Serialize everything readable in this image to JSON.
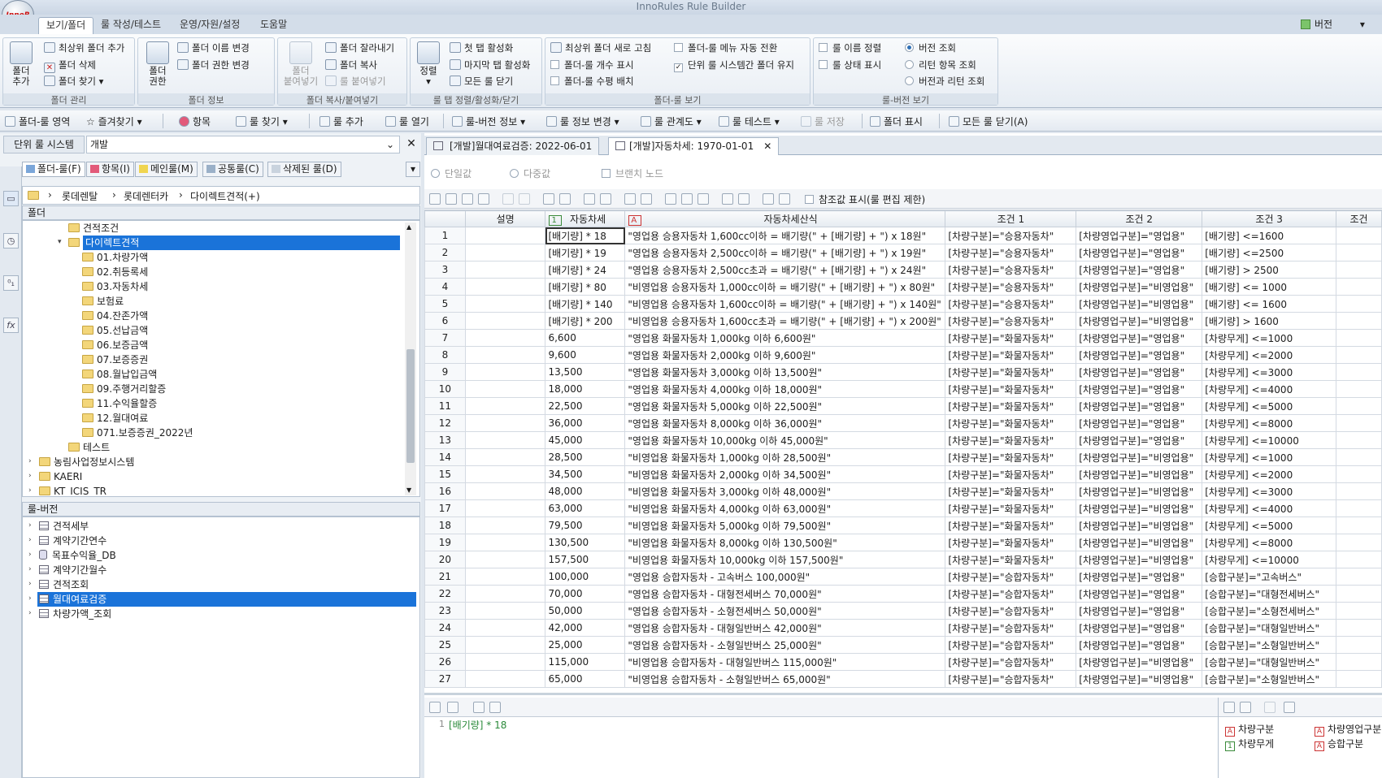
{
  "app": {
    "title": "InnoRules Rule Builder",
    "logo_text": "InnoR"
  },
  "ribbon_tabs": [
    "보기/폴더",
    "룰 작성/테스트",
    "운영/자원/설정",
    "도움말"
  ],
  "version_menu": "버전",
  "ribbon": {
    "folder_mgmt": {
      "caption": "폴더 관리",
      "add_folder": "폴더\n추가",
      "add_top": "최상위 폴더 추가",
      "delete": "폴더 삭제",
      "find": "폴더 찾기"
    },
    "folder_info": {
      "caption": "폴더 정보",
      "perm": "폴더\n권한",
      "rename": "폴더 이름 변경",
      "perm_change": "폴더 권한 변경"
    },
    "folder_copy": {
      "caption": "폴더 복사/붙여넣기",
      "paste": "폴더\n붙여넣기",
      "cut": "폴더 잘라내기",
      "copy": "폴더 복사",
      "paste_rule": "룰 붙여넣기"
    },
    "tab_sort": {
      "caption": "룰 탭 정렬/활성화/닫기",
      "sort": "정렬",
      "first": "첫 탭 활성화",
      "last": "마지막 탭 활성화",
      "close_all": "모든 룰 닫기"
    },
    "folder_rule_view": {
      "caption": "폴더-룰 보기",
      "refresh_top": "최상위 폴더 새로 고침",
      "show_count": "폴더-룰 개수 표시",
      "level": "폴더-룰 수평 배치",
      "menu_auto": "폴더-룰 메뉴 자동 전환",
      "keep_folder": "단위 룰 시스템간 폴더 유지"
    },
    "rule_version_view": {
      "caption": "룰-버전 보기",
      "name_sort": "룰 이름 정렬",
      "status": "룰 상태 표시",
      "ver_query": "버전 조회",
      "return_query": "리턴 항목 조회",
      "ver_return": "버전과 리턴 조회"
    }
  },
  "toolbar": [
    "폴더-룰 영역",
    "즐겨찾기",
    "항목",
    "룰 찾기",
    "룰 추가",
    "룰 열기",
    "룰-버전 정보",
    "룰 정보 변경",
    "룰 관계도",
    "룰 테스트",
    "룰 저장",
    "폴더 표시",
    "모든 룰 닫기(A)"
  ],
  "rule_system": {
    "label": "단위 룰 시스템",
    "value": "개발"
  },
  "left_tabs": [
    "폴더-룰(F)",
    "항목(I)",
    "메인룰(M)",
    "공통룰(C)",
    "삭제된 룰(D)"
  ],
  "breadcrumb": [
    "롯데렌탈",
    "롯데렌터카",
    "다이렉트견적(+)"
  ],
  "folder_header": "폴더",
  "folder_tree": [
    "견적조건",
    "다이렉트견적",
    "01.차량가액",
    "02.취등록세",
    "03.자동차세",
    "보험료",
    "04.잔존가액",
    "05.선납금액",
    "06.보증금액",
    "07.보증증권",
    "08.월납입금액",
    "09.주행거리할증",
    "11.수익율할증",
    "12.월대여료",
    "071.보증증권_2022년",
    "테스트",
    "농림사업정보시스템",
    "KAERI",
    "KT_ICIS_TR"
  ],
  "rule_header": "룰-버전",
  "rule_tree": [
    "견적세부",
    "계약기간연수",
    "목표수익율_DB",
    "계약기간월수",
    "견적조회",
    "월대여료검증",
    "차량가액_조회"
  ],
  "doc_tabs": [
    "[개발]월대여료검증: 2022-06-01",
    "[개발]자동차세: 1970-01-01"
  ],
  "value_options": {
    "single": "단일값",
    "multi": "다중값",
    "branch": "브랜치 노드"
  },
  "grid_toolbar": {
    "ref_display": "참조값 표시(룰 편집 제한)"
  },
  "columns": [
    "설명",
    "자동차세",
    "자동차세산식",
    "조건 1",
    "조건 2",
    "조건 3",
    "조건"
  ],
  "rows": [
    [
      "1",
      "",
      "[배기량] * 18",
      "\"영업용 승용자동차 1,600cc이하 = 배기량(\" + [배기량] + \") x 18원\"",
      "[차량구분]=\"승용자동차\"",
      "[차량영업구분]=\"영업용\"",
      "[배기량] <=1600"
    ],
    [
      "2",
      "",
      "[배기량] * 19",
      "\"영업용 승용자동차 2,500cc이하 = 배기량(\" + [배기량] + \") x 19원\"",
      "[차량구분]=\"승용자동차\"",
      "[차량영업구분]=\"영업용\"",
      "[배기량] <=2500"
    ],
    [
      "3",
      "",
      "[배기량] * 24",
      "\"영업용 승용자동차 2,500cc초과 = 배기량(\" + [배기량] + \") x 24원\"",
      "[차량구분]=\"승용자동차\"",
      "[차량영업구분]=\"영업용\"",
      "[배기량] > 2500"
    ],
    [
      "4",
      "",
      "[배기량] * 80",
      "\"비영업용 승용자동차 1,000cc이하 = 배기량(\" + [배기량] + \") x 80원\"",
      "[차량구분]=\"승용자동차\"",
      "[차량영업구분]=\"비영업용\"",
      "[배기량] <= 1000"
    ],
    [
      "5",
      "",
      "[배기량] * 140",
      "\"비영업용 승용자동차 1,600cc이하 = 배기량(\" + [배기량] + \") x 140원\"",
      "[차량구분]=\"승용자동차\"",
      "[차량영업구분]=\"비영업용\"",
      "[배기량] <= 1600"
    ],
    [
      "6",
      "",
      "[배기량] * 200",
      "\"비영업용 승용자동차 1,600cc초과 = 배기량(\" + [배기량] + \") x 200원\"",
      "[차량구분]=\"승용자동차\"",
      "[차량영업구분]=\"비영업용\"",
      "[배기량] > 1600"
    ],
    [
      "7",
      "",
      "6,600",
      "\"영업용 화물자동차 1,000kg 이하 6,600원\"",
      "[차량구분]=\"화물자동차\"",
      "[차량영업구분]=\"영업용\"",
      "[차량무게] <=1000"
    ],
    [
      "8",
      "",
      "9,600",
      "\"영업용 화물자동차 2,000kg 이하 9,600원\"",
      "[차량구분]=\"화물자동차\"",
      "[차량영업구분]=\"영업용\"",
      "[차량무게] <=2000"
    ],
    [
      "9",
      "",
      "13,500",
      "\"영업용 화물자동차 3,000kg 이하 13,500원\"",
      "[차량구분]=\"화물자동차\"",
      "[차량영업구분]=\"영업용\"",
      "[차량무게] <=3000"
    ],
    [
      "10",
      "",
      "18,000",
      "\"영업용 화물자동차 4,000kg 이하 18,000원\"",
      "[차량구분]=\"화물자동차\"",
      "[차량영업구분]=\"영업용\"",
      "[차량무게] <=4000"
    ],
    [
      "11",
      "",
      "22,500",
      "\"영업용 화물자동차 5,000kg 이하 22,500원\"",
      "[차량구분]=\"화물자동차\"",
      "[차량영업구분]=\"영업용\"",
      "[차량무게] <=5000"
    ],
    [
      "12",
      "",
      "36,000",
      "\"영업용 화물자동차 8,000kg 이하 36,000원\"",
      "[차량구분]=\"화물자동차\"",
      "[차량영업구분]=\"영업용\"",
      "[차량무게] <=8000"
    ],
    [
      "13",
      "",
      "45,000",
      "\"영업용 화물자동차 10,000kg 이하 45,000원\"",
      "[차량구분]=\"화물자동차\"",
      "[차량영업구분]=\"영업용\"",
      "[차량무게] <=10000"
    ],
    [
      "14",
      "",
      "28,500",
      "\"비영업용 화물자동차 1,000kg 이하 28,500원\"",
      "[차량구분]=\"화물자동차\"",
      "[차량영업구분]=\"비영업용\"",
      "[차량무게] <=1000"
    ],
    [
      "15",
      "",
      "34,500",
      "\"비영업용 화물자동차 2,000kg 이하 34,500원\"",
      "[차량구분]=\"화물자동차\"",
      "[차량영업구분]=\"비영업용\"",
      "[차량무게] <=2000"
    ],
    [
      "16",
      "",
      "48,000",
      "\"비영업용 화물자동차 3,000kg 이하 48,000원\"",
      "[차량구분]=\"화물자동차\"",
      "[차량영업구분]=\"비영업용\"",
      "[차량무게] <=3000"
    ],
    [
      "17",
      "",
      "63,000",
      "\"비영업용 화물자동차 4,000kg 이하 63,000원\"",
      "[차량구분]=\"화물자동차\"",
      "[차량영업구분]=\"비영업용\"",
      "[차량무게] <=4000"
    ],
    [
      "18",
      "",
      "79,500",
      "\"비영업용 화물자동차 5,000kg 이하 79,500원\"",
      "[차량구분]=\"화물자동차\"",
      "[차량영업구분]=\"비영업용\"",
      "[차량무게] <=5000"
    ],
    [
      "19",
      "",
      "130,500",
      "\"비영업용 화물자동차 8,000kg 이하 130,500원\"",
      "[차량구분]=\"화물자동차\"",
      "[차량영업구분]=\"비영업용\"",
      "[차량무게] <=8000"
    ],
    [
      "20",
      "",
      "157,500",
      "\"비영업용 화물자동차 10,000kg 이하 157,500원\"",
      "[차량구분]=\"화물자동차\"",
      "[차량영업구분]=\"비영업용\"",
      "[차량무게] <=10000"
    ],
    [
      "21",
      "",
      "100,000",
      "\"영업용 승합자동차 - 고속버스 100,000원\"",
      "[차량구분]=\"승합자동차\"",
      "[차량영업구분]=\"영업용\"",
      "[승합구분]=\"고속버스\""
    ],
    [
      "22",
      "",
      "70,000",
      "\"영업용 승합자동차 - 대형전세버스 70,000원\"",
      "[차량구분]=\"승합자동차\"",
      "[차량영업구분]=\"영업용\"",
      "[승합구분]=\"대형전세버스\""
    ],
    [
      "23",
      "",
      "50,000",
      "\"영업용 승합자동차 - 소형전세버스 50,000원\"",
      "[차량구분]=\"승합자동차\"",
      "[차량영업구분]=\"영업용\"",
      "[승합구분]=\"소형전세버스\""
    ],
    [
      "24",
      "",
      "42,000",
      "\"영업용 승합자동차 - 대형일반버스 42,000원\"",
      "[차량구분]=\"승합자동차\"",
      "[차량영업구분]=\"영업용\"",
      "[승합구분]=\"대형일반버스\""
    ],
    [
      "25",
      "",
      "25,000",
      "\"영업용 승합자동차 - 소형일반버스 25,000원\"",
      "[차량구분]=\"승합자동차\"",
      "[차량영업구분]=\"영업용\"",
      "[승합구분]=\"소형일반버스\""
    ],
    [
      "26",
      "",
      "115,000",
      "\"비영업용 승합자동차 - 대형일반버스 115,000원\"",
      "[차량구분]=\"승합자동차\"",
      "[차량영업구분]=\"비영업용\"",
      "[승합구분]=\"대형일반버스\""
    ],
    [
      "27",
      "",
      "65,000",
      "\"비영업용 승합자동차 - 소형일반버스 65,000원\"",
      "[차량구분]=\"승합자동차\"",
      "[차량영업구분]=\"비영업용\"",
      "[승합구분]=\"소형일반버스\""
    ]
  ],
  "formula": {
    "line_no": "1",
    "text": "[배기량] * 18"
  },
  "params": [
    "차량구분",
    "차량영업구분",
    "차량무게",
    "승합구분"
  ],
  "colors": {
    "selection": "#1a73d9",
    "accent": "#2f6fb6"
  }
}
